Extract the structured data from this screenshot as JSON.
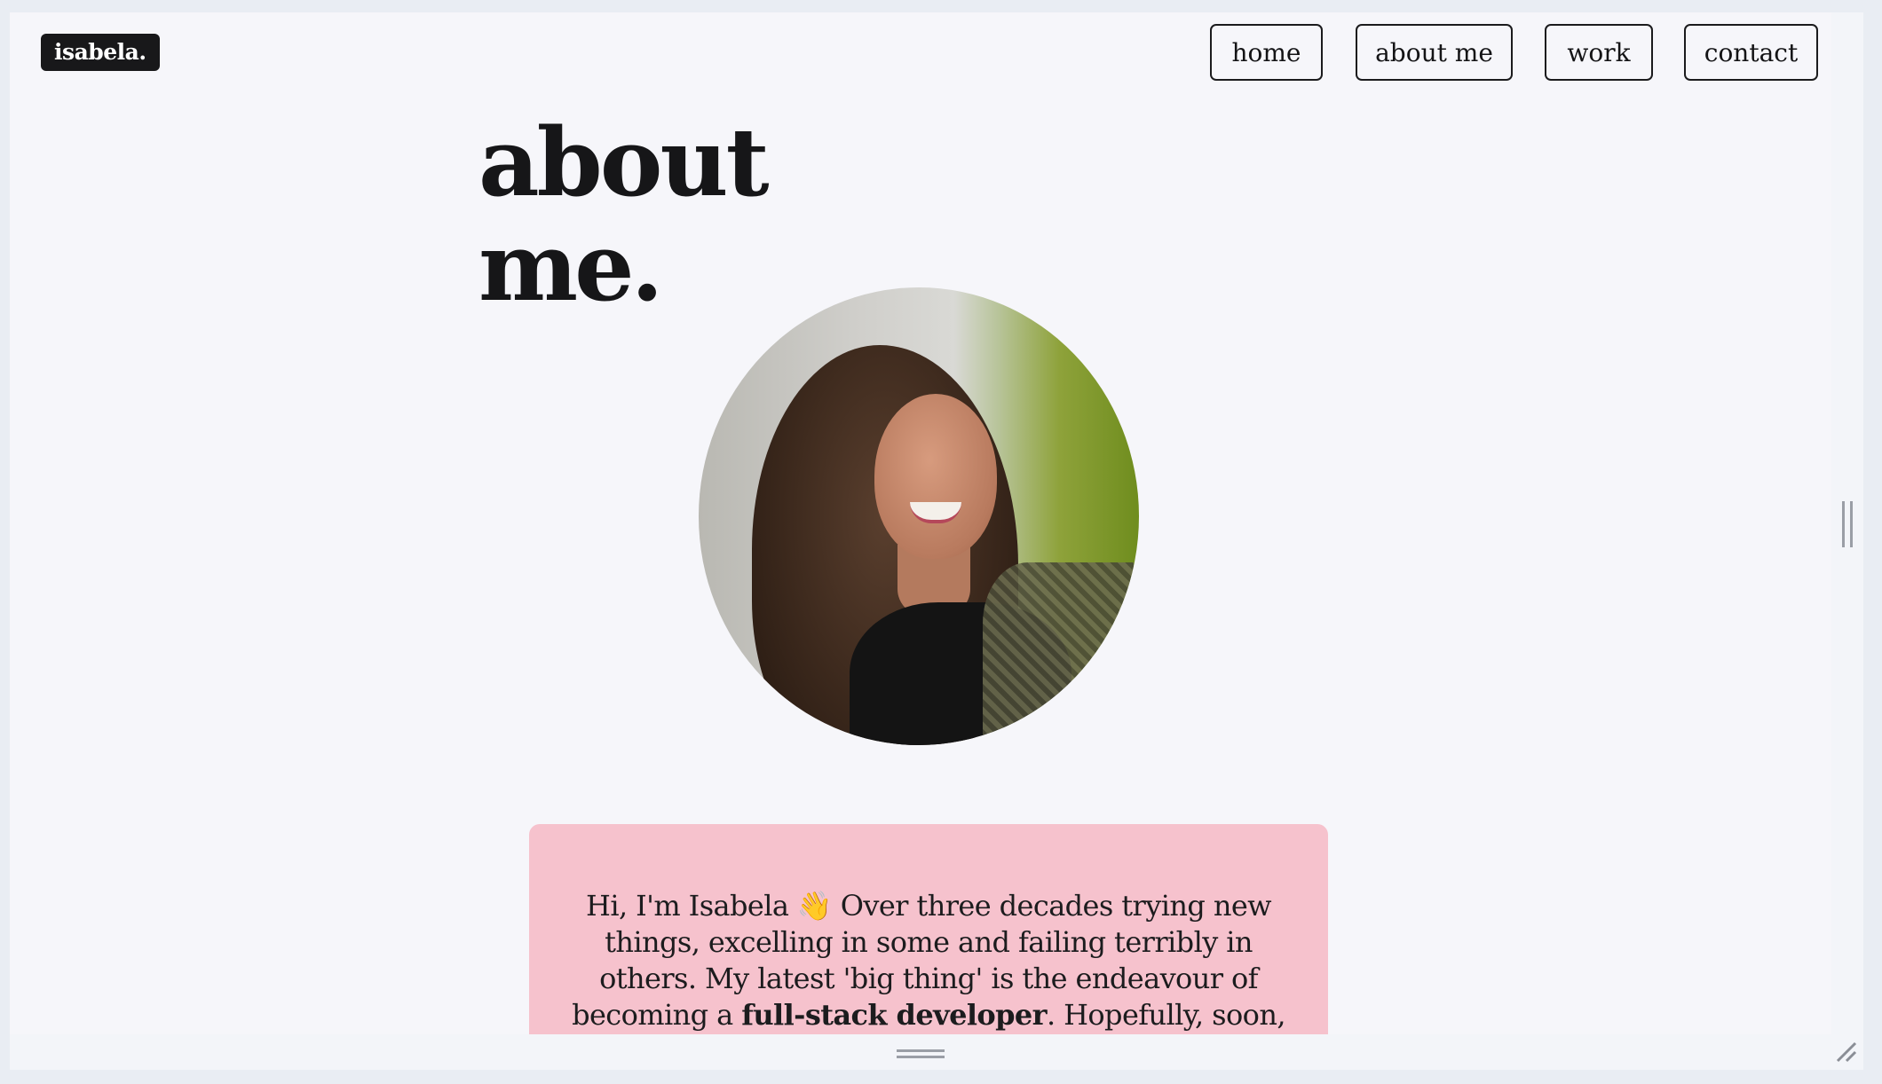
{
  "site": {
    "logo": "isabela."
  },
  "nav": {
    "items": [
      {
        "label": "home"
      },
      {
        "label": "about me"
      },
      {
        "label": "work"
      },
      {
        "label": "contact"
      }
    ]
  },
  "hero": {
    "title_line1": "about",
    "title_line2": "me."
  },
  "portrait": {
    "alt": "portrait photo"
  },
  "bio": {
    "part1": "Hi, I'm Isabela 👋 Over three decades trying new things, excelling in some and failing terribly in others. My latest 'big thing' is the endeavour of becoming a ",
    "highlight": "full-stack developer",
    "part2": ". Hopefully, soon, I'll look back at"
  },
  "colors": {
    "page_bg": "#f6f6fa",
    "card_bg": "#f6c2cd",
    "logo_bg": "#18181a",
    "text": "#161618"
  }
}
